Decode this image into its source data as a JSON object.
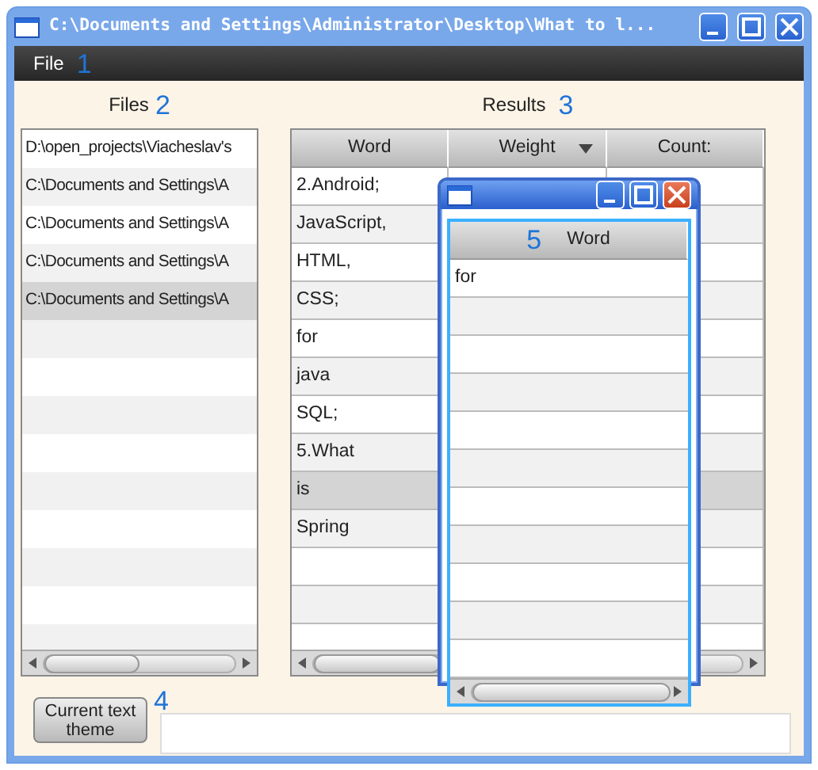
{
  "window": {
    "title": "C:\\Documents and Settings\\Administrator\\Desktop\\What to l..."
  },
  "menu": {
    "items": [
      "File"
    ],
    "marker": "1"
  },
  "files": {
    "label": "Files",
    "marker": "2",
    "rows": [
      {
        "text": "D:\\open_projects\\Viacheslav's",
        "selected": false
      },
      {
        "text": "C:\\Documents and Settings\\A",
        "selected": false
      },
      {
        "text": "C:\\Documents and Settings\\A",
        "selected": false
      },
      {
        "text": "C:\\Documents and Settings\\A",
        "selected": false
      },
      {
        "text": "C:\\Documents and Settings\\A",
        "selected": true
      }
    ]
  },
  "results": {
    "label": "Results",
    "marker": "3",
    "columns": [
      {
        "label": "Word",
        "sorted": false
      },
      {
        "label": "Weight",
        "sorted": true
      },
      {
        "label": "Count:",
        "sorted": false
      }
    ],
    "rows": [
      {
        "word": "2.Android;",
        "selected": false
      },
      {
        "word": "JavaScript,",
        "selected": false
      },
      {
        "word": "HTML,",
        "selected": false
      },
      {
        "word": "CSS;",
        "selected": false
      },
      {
        "word": "for",
        "selected": false
      },
      {
        "word": "java",
        "selected": false
      },
      {
        "word": "SQL;",
        "selected": false
      },
      {
        "word": "5.What",
        "selected": false
      },
      {
        "word": "is",
        "selected": true
      },
      {
        "word": "Spring",
        "selected": false
      }
    ]
  },
  "bottom": {
    "marker": "4",
    "button": "Current text theme"
  },
  "popup": {
    "marker": "5",
    "column": "Word",
    "rows": [
      {
        "word": "for"
      }
    ]
  }
}
